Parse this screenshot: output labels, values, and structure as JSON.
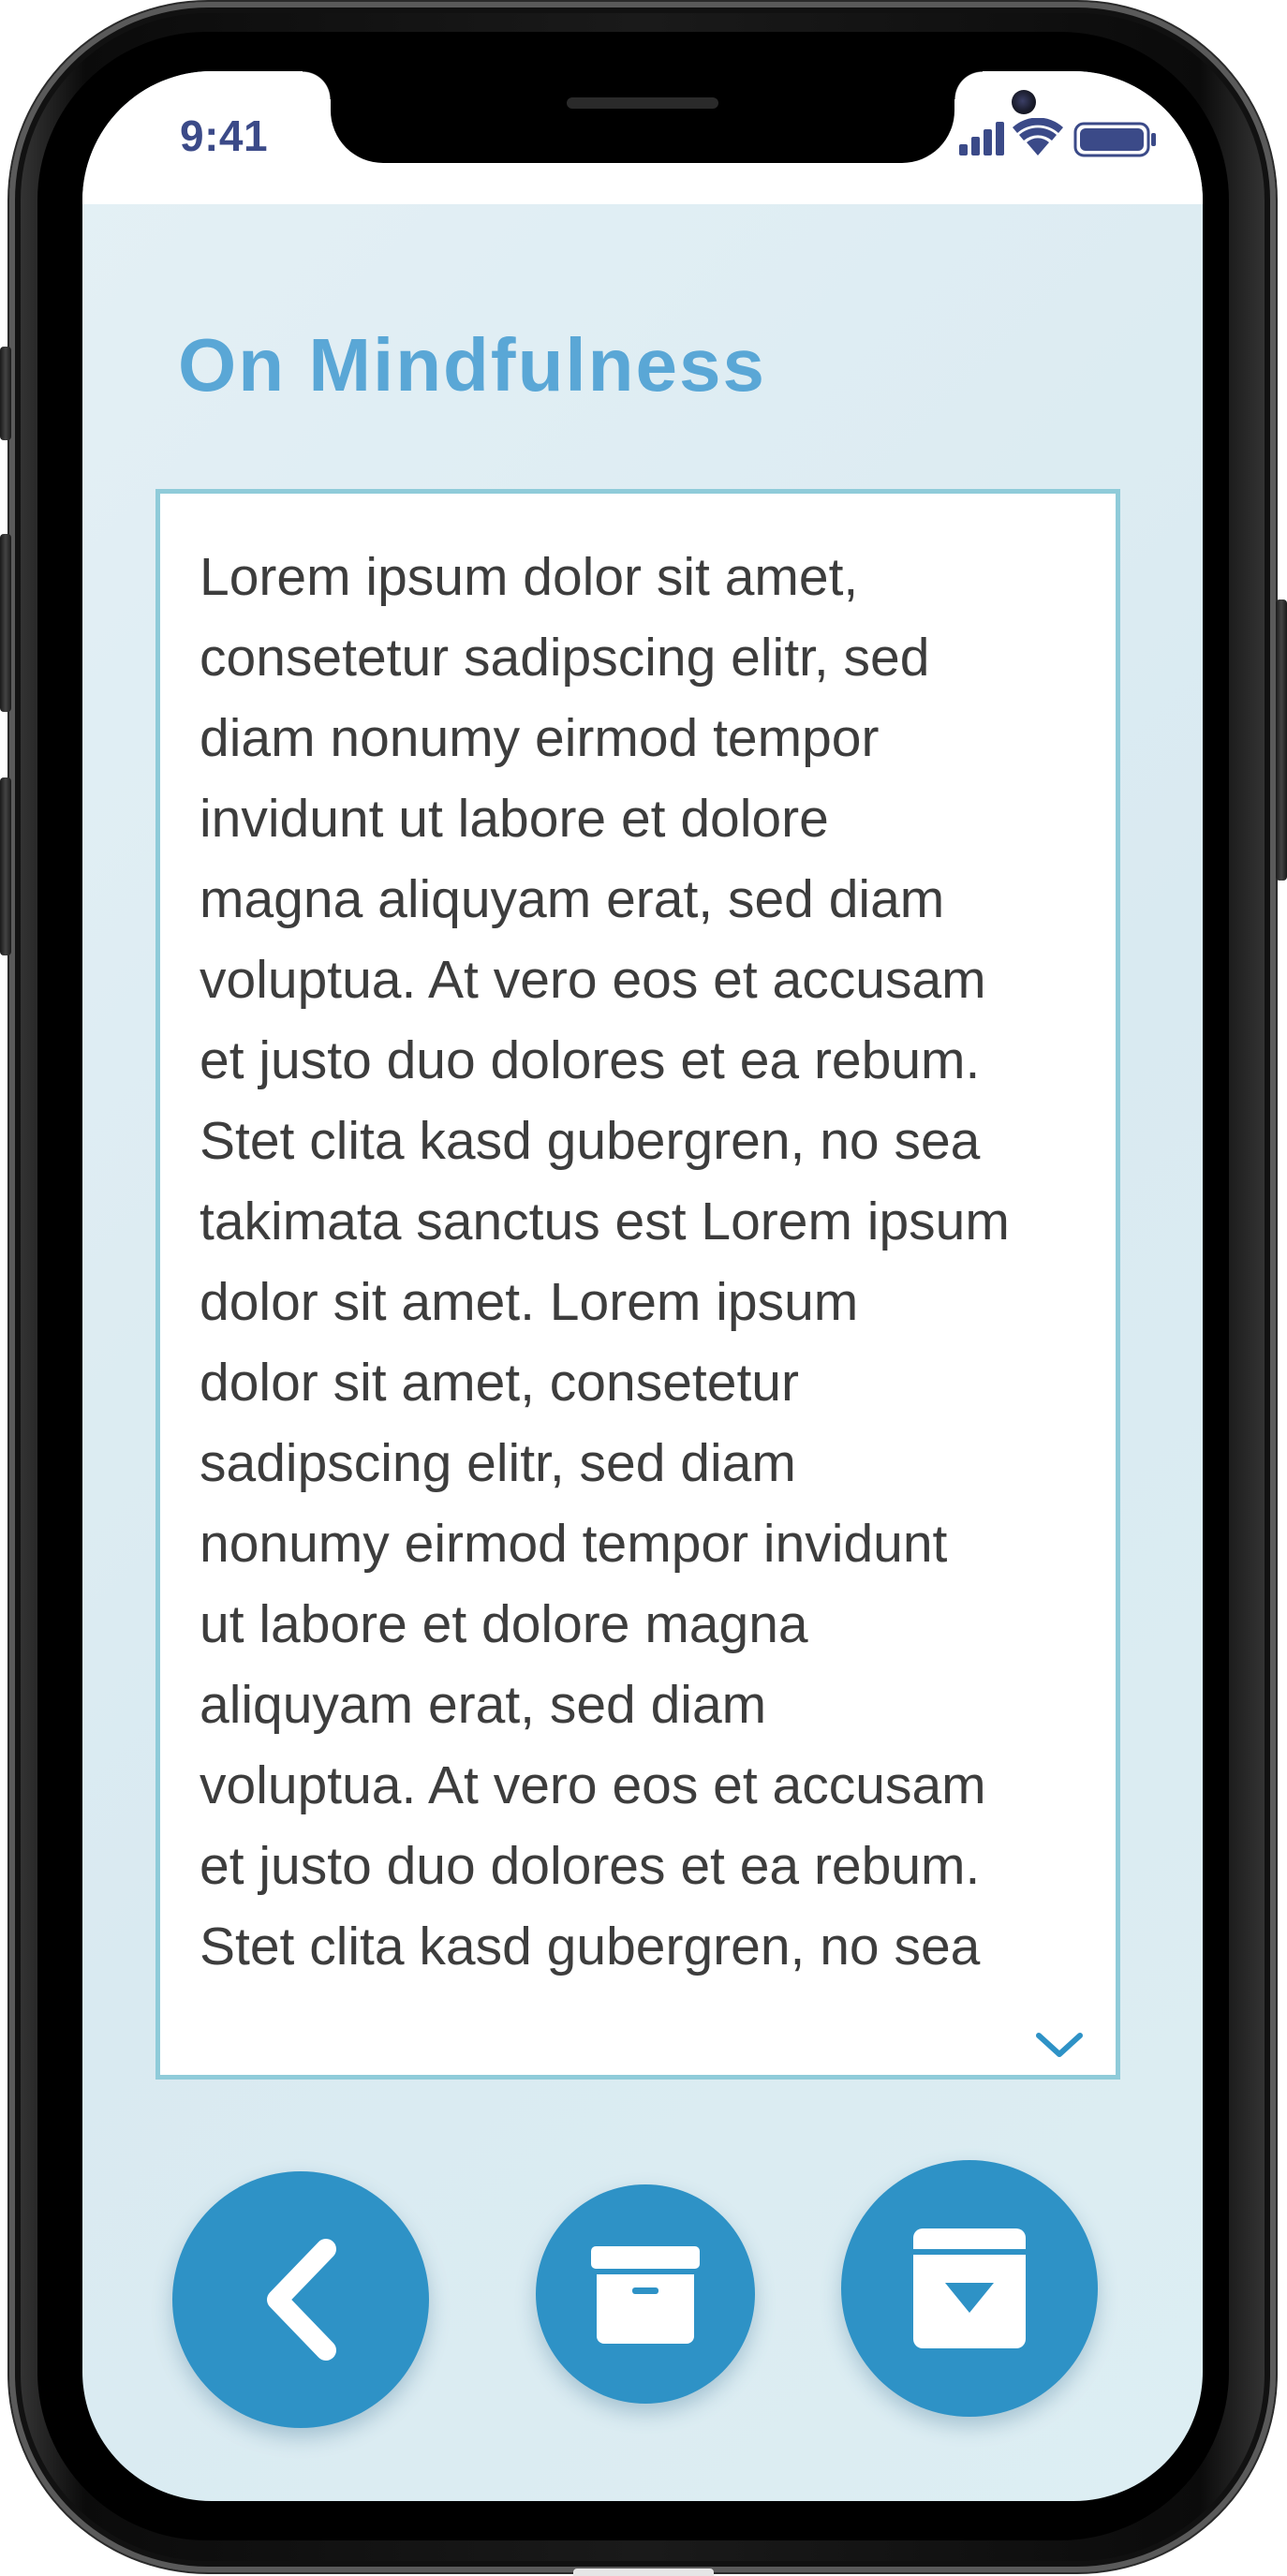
{
  "status_bar": {
    "time": "9:41",
    "icons": [
      "cellular-signal-icon",
      "wifi-icon",
      "battery-icon"
    ]
  },
  "article": {
    "title": "On Mindfulness",
    "body": "Lorem ipsum dolor sit amet,\nconsetetur sadipscing elitr, sed\ndiam nonumy eirmod tempor\ninvidunt ut labore et dolore\nmagna aliquyam erat, sed diam\nvoluptua. At vero eos et accusam\net justo duo dolores et ea rebum.\nStet clita kasd gubergren, no sea\ntakimata sanctus est Lorem ipsum\ndolor sit amet. Lorem ipsum\ndolor sit amet, consetetur\nsadipscing elitr, sed diam\nnonumy eirmod tempor invidunt\nut labore et dolore magna\naliquyam erat, sed diam\nvoluptua. At vero eos et accusam\net justo duo dolores et ea rebum.\nStet clita kasd gubergren, no sea",
    "scroll_indicator_icon": "chevron-down-icon"
  },
  "actions": [
    {
      "name": "back",
      "icon": "chevron-left-icon"
    },
    {
      "name": "archive",
      "icon": "archive-box-icon"
    },
    {
      "name": "save",
      "icon": "archive-download-icon"
    }
  ],
  "colors": {
    "accent": "#2e92c6",
    "title": "#5aa7d6",
    "card_border": "#8fcbd9",
    "background": "#dcecf2",
    "status_text": "#3b4a88"
  }
}
